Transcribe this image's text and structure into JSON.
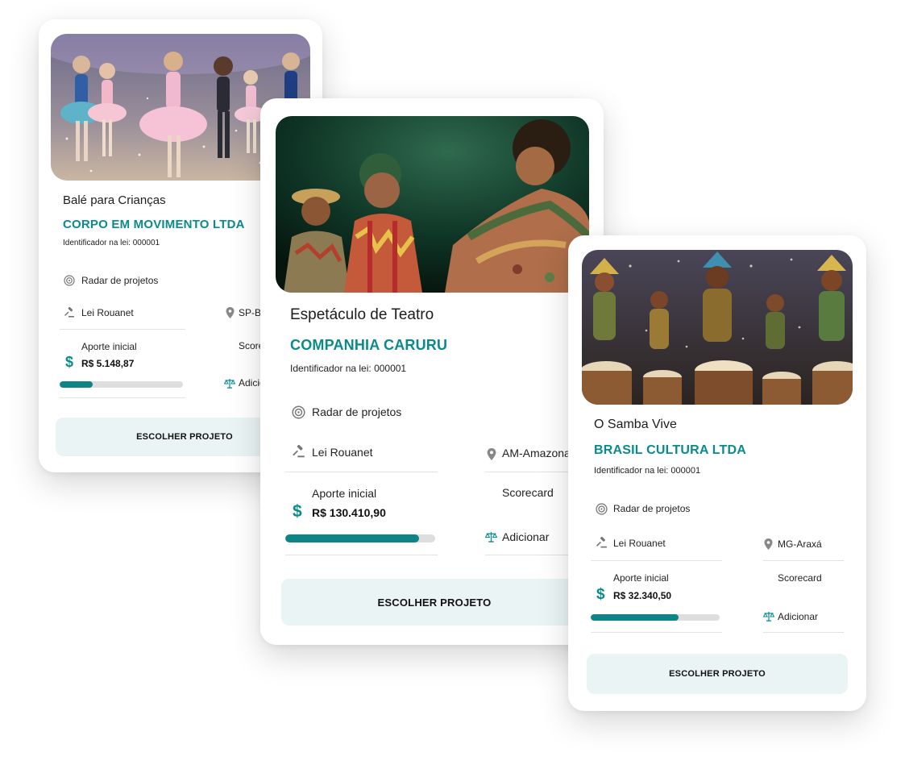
{
  "colors": {
    "accent": "#0b8a8c",
    "progress": "#0e8486",
    "button_bg": "#eaf4f4"
  },
  "cards": [
    {
      "title": "Balé para Crianças",
      "company": "CORPO EM MOVIMENTO LTDA",
      "identifier": "Identificador na lei: 000001",
      "radar": "Radar de projetos",
      "law": "Lei Rouanet",
      "location": "SP-Ba",
      "aporte_label": "Aporte inicial",
      "aporte_value": "R$ 5.148,87",
      "scorecard": "Score",
      "add": "Adicion",
      "progress": 0.27,
      "button": "ESCOLHER PROJETO"
    },
    {
      "title": "Espetáculo de Teatro",
      "company": "COMPANHIA CARURU",
      "identifier": "Identificador na lei: 000001",
      "radar": "Radar de projetos",
      "law": "Lei Rouanet",
      "location": "AM-Amazona",
      "aporte_label": "Aporte inicial",
      "aporte_value": "R$ 130.410,90",
      "scorecard": "Scorecard",
      "add": "Adicionar",
      "progress": 0.89,
      "button": "ESCOLHER PROJETO"
    },
    {
      "title": "O Samba Vive",
      "company": "BRASIL CULTURA LTDA",
      "identifier": "Identificador na lei: 000001",
      "radar": "Radar de projetos",
      "law": "Lei Rouanet",
      "location": "MG-Araxá",
      "aporte_label": "Aporte inicial",
      "aporte_value": "R$ 32.340,50",
      "scorecard": "Scorecard",
      "add": "Adicionar",
      "progress": 0.68,
      "button": "ESCOLHER PROJETO"
    }
  ]
}
